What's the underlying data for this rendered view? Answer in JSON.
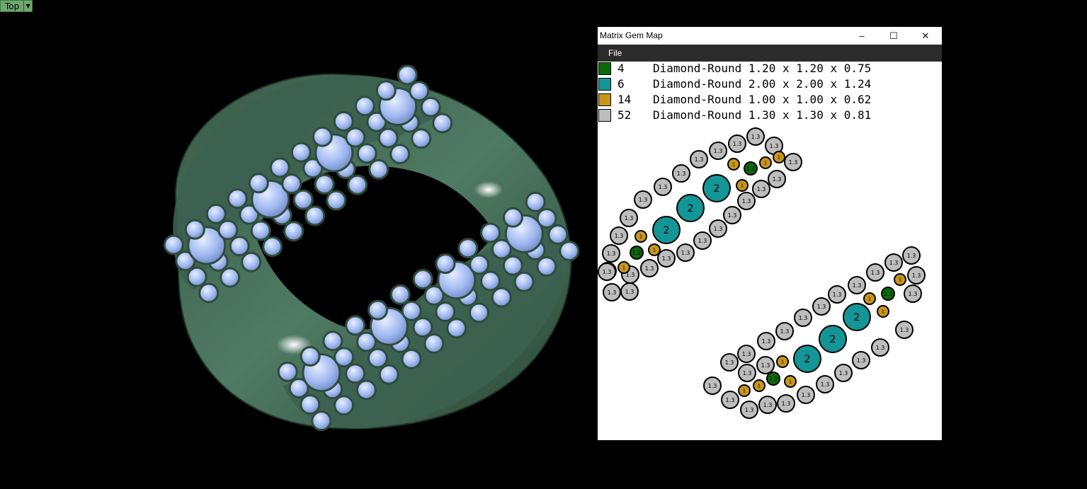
{
  "viewport": {
    "label": "Top",
    "dropdown_icon": "triangle-down-icon"
  },
  "gem_window": {
    "title": "Matrix Gem Map",
    "controls": {
      "minimize": "–",
      "maximize": "☐",
      "close": "✕"
    },
    "menu": {
      "file": "File"
    },
    "legend": [
      {
        "count": "4",
        "desc": "Diamond-Round 1.20 x 1.20 x 0.75",
        "color": "#0a6b0a"
      },
      {
        "count": "6",
        "desc": "Diamond-Round 2.00 x 2.00 x 1.24",
        "color": "#149596"
      },
      {
        "count": "14",
        "desc": "Diamond-Round 1.00 x 1.00 x 0.62",
        "color": "#c8961a"
      },
      {
        "count": "52",
        "desc": "Diamond-Round 1.30 x 1.30 x 0.81",
        "color": "#bdbdbd"
      }
    ],
    "gem_labels": {
      "size_2": "2",
      "size_1_3": "1.3",
      "size_1": "1",
      "size_1_2": "1.2"
    }
  }
}
